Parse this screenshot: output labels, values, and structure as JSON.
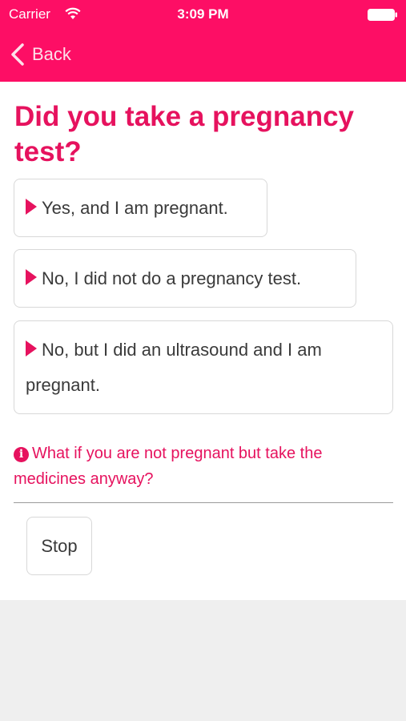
{
  "status_bar": {
    "carrier": "Carrier",
    "time": "3:09 PM"
  },
  "nav": {
    "back_label": "Back"
  },
  "question": {
    "title": "Did you take a pregnancy test?"
  },
  "options": [
    {
      "label": "Yes, and I am pregnant."
    },
    {
      "label": "No, I did not do a pregnancy test."
    },
    {
      "label": "No, but I did an ultrasound and I am pregnant."
    }
  ],
  "info": {
    "icon": "info-icon",
    "text": "What if you are not pregnant but take the medicines anyway?"
  },
  "stop_button": {
    "label": "Stop"
  },
  "colors": {
    "nav_background": "#fd0e65",
    "accent": "#e6125e",
    "content_background": "#ffffff",
    "page_background": "#efefef"
  }
}
